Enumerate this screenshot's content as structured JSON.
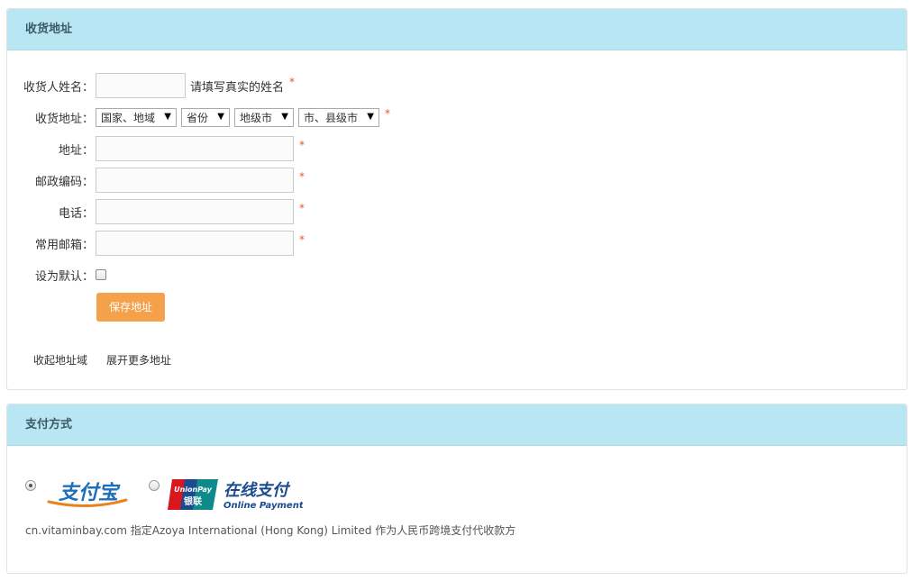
{
  "address_section": {
    "title": "收货地址",
    "name_label": "收货人姓名：",
    "name_hint": "请填写真实的姓名",
    "region_label": "收货地址：",
    "country_select": "国家、地域",
    "province_select": "省份",
    "city_select": "地级市",
    "county_select": "市、县级市",
    "street_label": "地址：",
    "postcode_label": "邮政编码：",
    "phone_label": "电话：",
    "email_label": "常用邮箱：",
    "default_label": "设为默认：",
    "required_mark": "*",
    "save_button": "保存地址",
    "collapse_link": "收起地址域",
    "expand_link": "展开更多地址"
  },
  "payment_section": {
    "title": "支付方式",
    "alipay_logo": "支付宝",
    "unionpay_badge_top": "UnionPay",
    "unionpay_badge_bottom": "银联",
    "unionpay_cn": "在线支付",
    "unionpay_en": "Online Payment",
    "note": "cn.vitaminbay.com 指定Azoya International (Hong Kong) Limited 作为人民币跨境支付代收款方"
  },
  "colors": {
    "header_bg": "#b9e6f3",
    "save_button": "#f5a04a",
    "required": "#e8542a",
    "alipay_blue": "#1c6fb8",
    "alipay_orange": "#e8821e",
    "unionpay_red": "#d7161e",
    "unionpay_blue": "#1a4b8e",
    "unionpay_green": "#0f8a8a"
  },
  "icons": [
    "caret-down-icon",
    "alipay-logo",
    "unionpay-logo"
  ]
}
